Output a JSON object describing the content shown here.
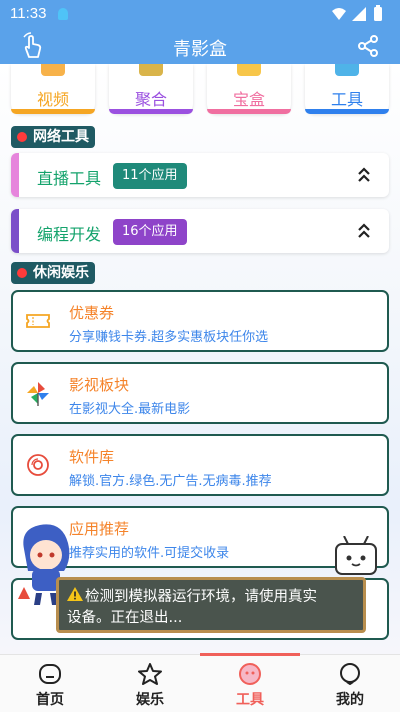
{
  "status_bar": {
    "time": "11:33"
  },
  "app_bar": {
    "title": "青影盒"
  },
  "categories": [
    {
      "label": "视频",
      "color": "#f5a623",
      "bar": "#f5a623"
    },
    {
      "label": "聚合",
      "color": "#9b51e0",
      "bar": "#9b51e0"
    },
    {
      "label": "宝盒",
      "color": "#f06fa0",
      "bar": "#f06fa0"
    },
    {
      "label": "工具",
      "color": "#2f80ed",
      "bar": "#2f80ed"
    }
  ],
  "sections": {
    "network_tools": "网络工具",
    "leisure": "休闲娱乐"
  },
  "groups": [
    {
      "name": "直播工具",
      "count": "11个应用",
      "bar": "#e685dc",
      "badge": "#1f8a7a"
    },
    {
      "name": "编程开发",
      "count": "16个应用",
      "bar": "#7b4fc9",
      "badge": "#8e44c9"
    }
  ],
  "cards": [
    {
      "title": "优惠券",
      "subtitle": "分享赚钱卡券.超多实惠板块任你选",
      "icon": "coupon-icon"
    },
    {
      "title": "影视板块",
      "subtitle": "在影视大全.最新电影",
      "icon": "pinwheel-icon"
    },
    {
      "title": "软件库",
      "subtitle": "解锁.官方.绿色.无广告.无病毒.推荐",
      "icon": "disc-icon"
    },
    {
      "title": "应用推荐",
      "subtitle": "推荐实用的软件.可提交收录",
      "icon": "app-icon"
    }
  ],
  "toast": {
    "line1": "检测到模拟器运行环境，请使用真实",
    "line2": "设备。正在退出..."
  },
  "tabs": [
    {
      "label": "首页",
      "icon": "home-icon",
      "active": false
    },
    {
      "label": "娱乐",
      "icon": "star-icon",
      "active": false
    },
    {
      "label": "工具",
      "icon": "tools-icon",
      "active": true
    },
    {
      "label": "我的",
      "icon": "profile-icon",
      "active": false
    }
  ],
  "colors": {
    "app_bar": "#5aa2ea",
    "accent": "#f0605a",
    "card_title": "#f5832a",
    "card_sub": "#3d86ea",
    "group_name": "#14a36c"
  }
}
